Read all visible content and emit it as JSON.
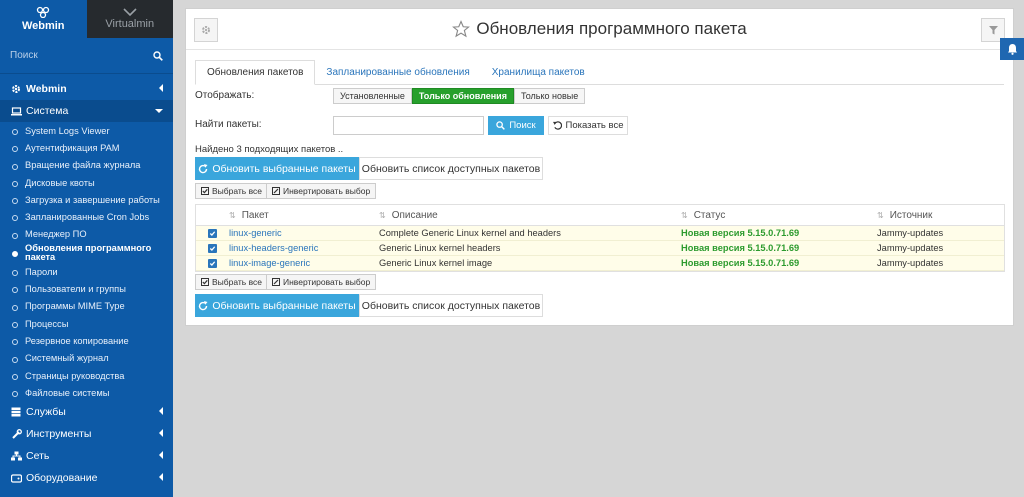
{
  "sidebar": {
    "brand_webmin": "Webmin",
    "brand_virtualmin": "Virtualmin",
    "search_placeholder": "Поиск",
    "categories": [
      {
        "label": "Webmin"
      },
      {
        "label": "Система"
      },
      {
        "label": "Службы"
      },
      {
        "label": "Инструменты"
      },
      {
        "label": "Сеть"
      },
      {
        "label": "Оборудование"
      }
    ],
    "system_items": [
      "System Logs Viewer",
      "Аутентификация PAM",
      "Вращение файла журнала",
      "Дисковые квоты",
      "Загрузка и завершение работы",
      "Запланированные Cron Jobs",
      "Менеджер ПО",
      "Обновления программного пакета",
      "Пароли",
      "Пользователи и группы",
      "Программы MIME Type",
      "Процессы",
      "Резервное копирование",
      "Системный журнал",
      "Страницы руководства",
      "Файловые системы"
    ]
  },
  "header": {
    "title": "Обновления программного пакета"
  },
  "tabs": [
    "Обновления пакетов",
    "Запланированные обновления",
    "Хранилища пакетов"
  ],
  "filter": {
    "label": "Отображать:",
    "options": [
      "Установленные",
      "Только обновления",
      "Только новые"
    ],
    "selected": "Только обновления"
  },
  "find": {
    "label": "Найти пакеты:",
    "value": "",
    "search_button": "Поиск",
    "show_all_button": "Показать все"
  },
  "found_text": "Найдено 3 подходящих пакетов ..",
  "actions": {
    "update_selected": "Обновить выбранные пакеты",
    "refresh_list": "Обновить список доступных пакетов",
    "select_all": "Выбрать все",
    "invert": "Инвертировать выбор"
  },
  "table": {
    "columns": [
      "Пакет",
      "Описание",
      "Статус",
      "Источник"
    ],
    "rows": [
      {
        "package": "linux-generic",
        "description": "Complete Generic Linux kernel and headers",
        "status": "Новая версия 5.15.0.71.69",
        "source": "Jammy-updates",
        "checked": true
      },
      {
        "package": "linux-headers-generic",
        "description": "Generic Linux kernel headers",
        "status": "Новая версия 5.15.0.71.69",
        "source": "Jammy-updates",
        "checked": true
      },
      {
        "package": "linux-image-generic",
        "description": "Generic Linux kernel image",
        "status": "Новая версия 5.15.0.71.69",
        "source": "Jammy-updates",
        "checked": true
      }
    ]
  },
  "colors": {
    "sidebar": "#0d5aa7",
    "accent": "#3aa6dc",
    "active_filter": "#27a02c",
    "status_green": "#2c9b2e",
    "row_highlight": "#fffde9"
  }
}
